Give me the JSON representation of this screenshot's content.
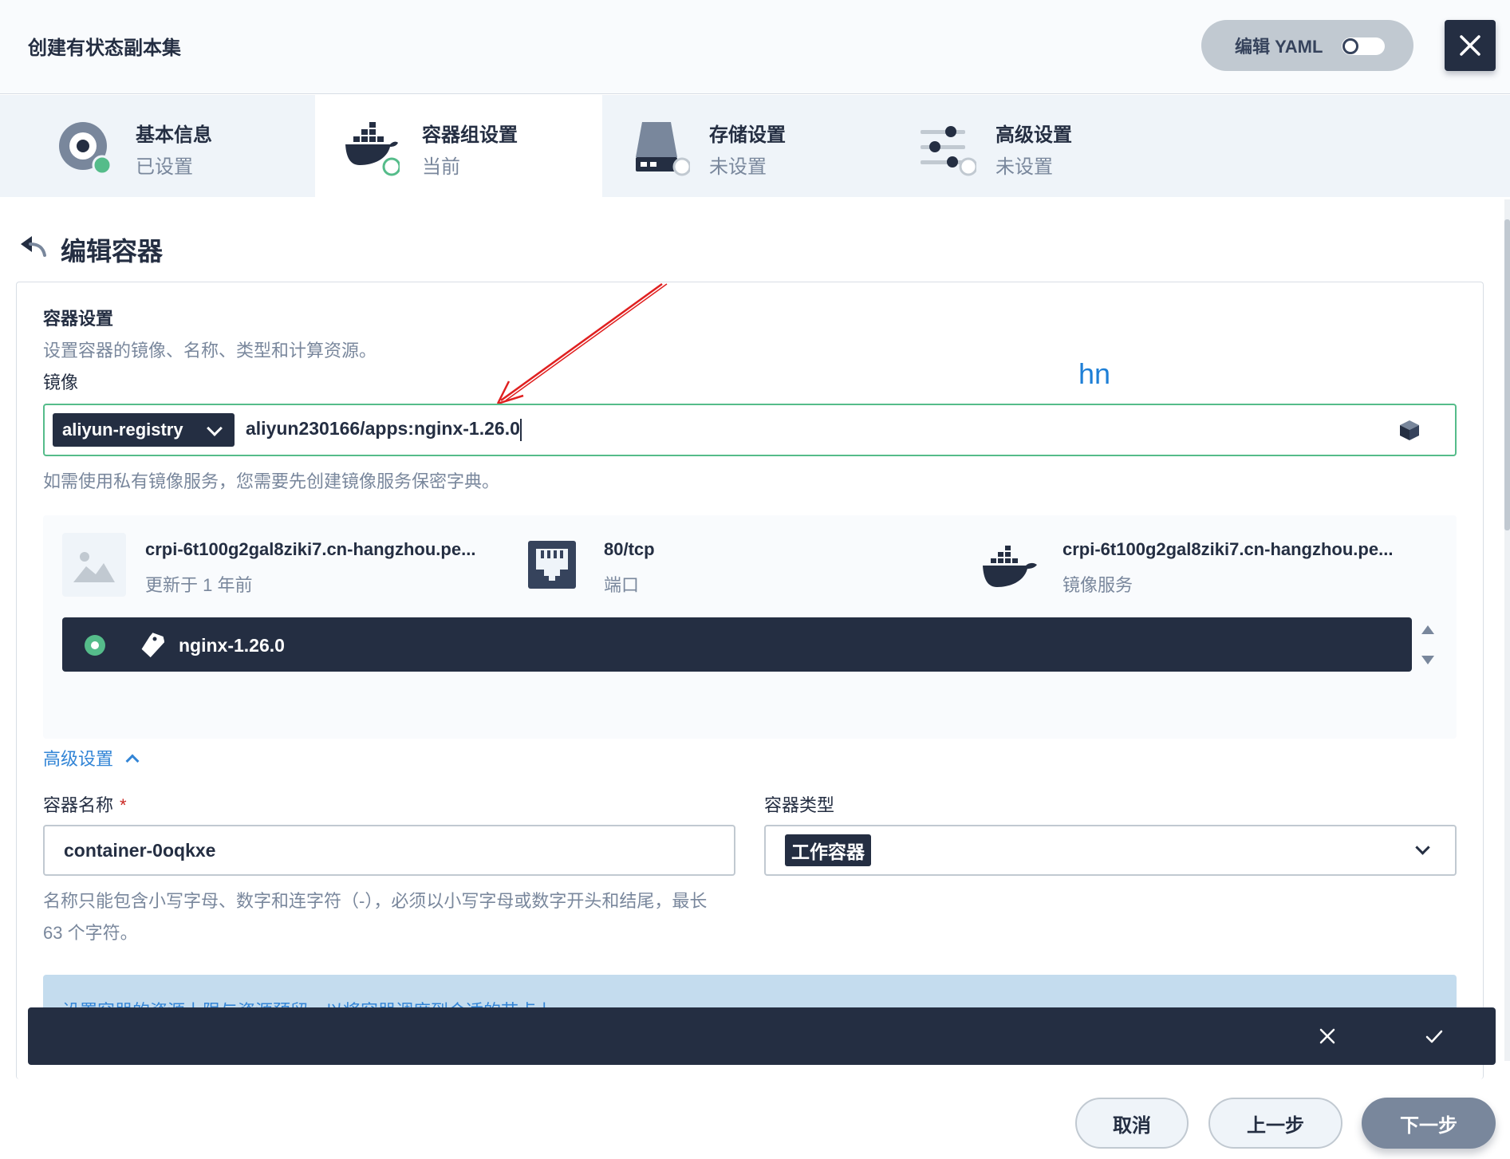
{
  "header": {
    "title": "创建有状态副本集",
    "yaml_label": "编辑 YAML",
    "close_icon": "close-icon"
  },
  "steps": [
    {
      "title": "基本信息",
      "status": "已设置",
      "icon": "settings-icon"
    },
    {
      "title": "容器组设置",
      "status": "当前",
      "icon": "docker-icon"
    },
    {
      "title": "存储设置",
      "status": "未设置",
      "icon": "storage-icon"
    },
    {
      "title": "高级设置",
      "status": "未设置",
      "icon": "sliders-icon"
    }
  ],
  "page": {
    "title": "编辑容器"
  },
  "container_settings": {
    "title": "容器设置",
    "description": "设置容器的镜像、名称、类型和计算资源。",
    "image_label": "镜像",
    "annotation": "hn",
    "registry": "aliyun-registry",
    "image_value": "aliyun230166/apps:nginx-1.26.0",
    "image_hint": "如需使用私有镜像服务，您需要先创建镜像服务保密字典。"
  },
  "image_card": {
    "image_name": "crpi-6t100g2gal8ziki7.cn-hangzhou.pe...",
    "updated": "更新于 1 年前",
    "port": "80/tcp",
    "port_label": "端口",
    "registry_name": "crpi-6t100g2gal8ziki7.cn-hangzhou.pe...",
    "registry_label": "镜像服务",
    "tag": "nginx-1.26.0"
  },
  "advanced": {
    "toggle_label": "高级设置",
    "name_label": "容器名称",
    "required_mark": "*",
    "name_value": "container-0oqkxe",
    "type_label": "容器类型",
    "type_value": "工作容器",
    "name_hint": "名称只能包含小写字母、数字和连字符（-），必须以小写字母或数字开头和结尾，最长 63 个字符。",
    "resource_hint": "设置容器的资源上限与资源预留，以将容器调度到合适的节点上。"
  },
  "footer": {
    "cancel": "取消",
    "prev": "上一步",
    "next": "下一步"
  },
  "colors": {
    "primary_dark": "#242e42",
    "success_green": "#55bc8a",
    "link_blue": "#3385d6",
    "annotation_red": "#e02020"
  }
}
